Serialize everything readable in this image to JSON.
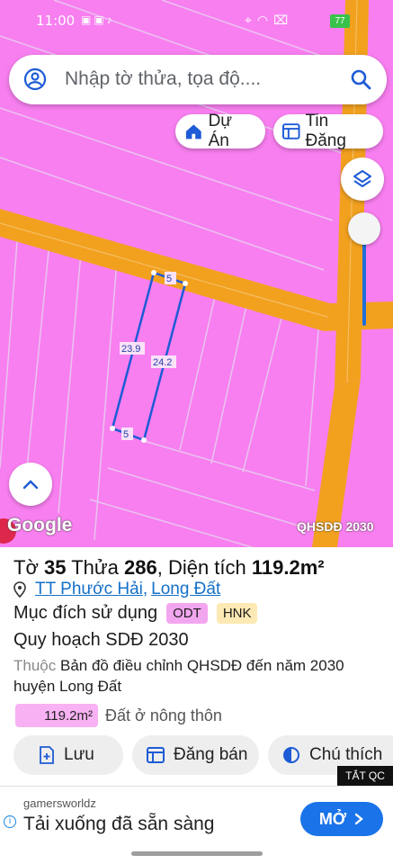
{
  "status_bar": {
    "time": "11:00",
    "battery": "77",
    "battery_color": "#39c24a"
  },
  "search": {
    "placeholder": "Nhập tờ thửa, tọa độ...."
  },
  "chips": {
    "du_an": "Dự Án",
    "tin_dang": "Tin Đăng"
  },
  "map": {
    "google": "Google",
    "layer": "QHSDĐ 2030",
    "dimensions": {
      "top": "5",
      "bottom": "5",
      "left": "23.9",
      "right": "24.2"
    },
    "colors": {
      "land": "#f87ff0",
      "road": "#f2a11f",
      "boundary": "#1e5bd6"
    }
  },
  "parcel": {
    "to_label": "Tờ",
    "to_value": "35",
    "thua_label": "Thửa",
    "thua_value": "286",
    "area_label": "Diện tích",
    "area_value": "119.2m²",
    "ward": "TT Phước Hải",
    "district": "Long Đất",
    "purpose_label": "Mục đích sử dụng",
    "tags": [
      "ODT",
      "HNK"
    ],
    "plan": "Quy hoạch SDĐ 2030",
    "belong_prefix": "Thuộc",
    "belong_text": "Bản đồ điều chỉnh QHSDĐ đến năm 2030 huyện Long Đất",
    "area_chip": "119.2m²",
    "land_type": "Đất ở nông thôn"
  },
  "actions": {
    "save": "Lưu",
    "sell": "Đăng bán",
    "legend": "Chú thích"
  },
  "ad": {
    "close": "TẮT QC",
    "source": "gamersworldz",
    "headline": "Tải xuống đã sẵn sàng",
    "cta": "MỞ"
  }
}
